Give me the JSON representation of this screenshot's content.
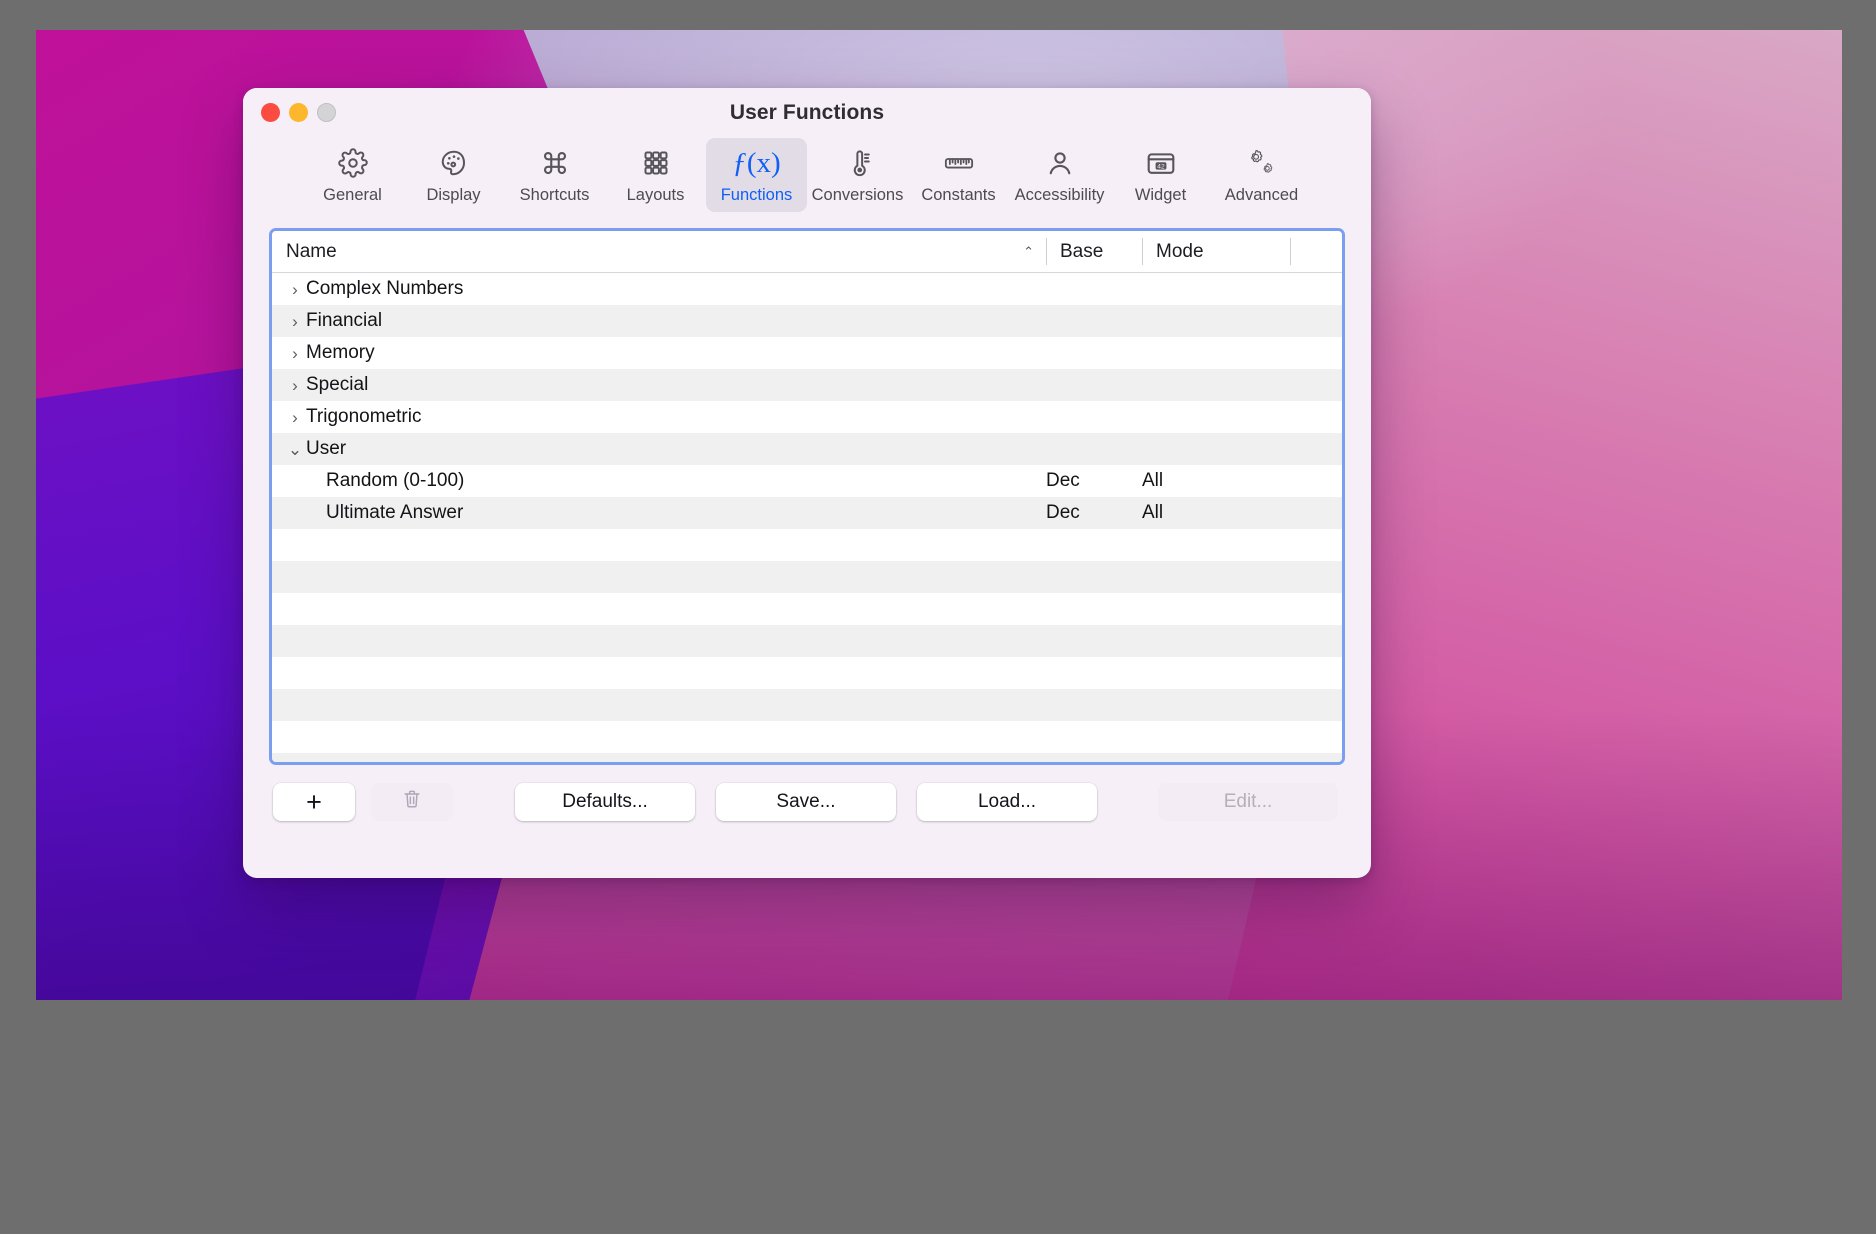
{
  "window": {
    "title": "User Functions",
    "traffic_lights": [
      {
        "name": "close",
        "color": "#fc4b41"
      },
      {
        "name": "minimize",
        "color": "#fdb72c"
      },
      {
        "name": "zoom",
        "color": "#d4d3d5"
      }
    ]
  },
  "toolbar": {
    "items": [
      {
        "label": "General",
        "icon": "gear-icon",
        "selected": false
      },
      {
        "label": "Display",
        "icon": "palette-icon",
        "selected": false
      },
      {
        "label": "Shortcuts",
        "icon": "command-key-icon",
        "selected": false
      },
      {
        "label": "Layouts",
        "icon": "grid-icon",
        "selected": false
      },
      {
        "label": "Functions",
        "icon": "fx-icon",
        "selected": true
      },
      {
        "label": "Conversions",
        "icon": "thermometer-icon",
        "selected": false
      },
      {
        "label": "Constants",
        "icon": "ruler-icon",
        "selected": false
      },
      {
        "label": "Accessibility",
        "icon": "person-icon",
        "selected": false
      },
      {
        "label": "Widget",
        "icon": "widget-42-icon",
        "selected": false
      },
      {
        "label": "Advanced",
        "icon": "two-gears-icon",
        "selected": false
      }
    ],
    "selected_color": "#1160f5"
  },
  "table": {
    "columns": [
      {
        "key": "name",
        "label": "Name",
        "sort": "ascending",
        "sort_glyph": "⌃"
      },
      {
        "key": "base",
        "label": "Base"
      },
      {
        "key": "mode",
        "label": "Mode"
      }
    ],
    "focus_ring_color": "#7a9ef0",
    "rows": [
      {
        "type": "group",
        "expanded": false,
        "chevron": "›",
        "name": "Complex Numbers",
        "base": "",
        "mode": ""
      },
      {
        "type": "group",
        "expanded": false,
        "chevron": "›",
        "name": "Financial",
        "base": "",
        "mode": ""
      },
      {
        "type": "group",
        "expanded": false,
        "chevron": "›",
        "name": "Memory",
        "base": "",
        "mode": ""
      },
      {
        "type": "group",
        "expanded": false,
        "chevron": "›",
        "name": "Special",
        "base": "",
        "mode": ""
      },
      {
        "type": "group",
        "expanded": false,
        "chevron": "›",
        "name": "Trigonometric",
        "base": "",
        "mode": ""
      },
      {
        "type": "group",
        "expanded": true,
        "chevron": "⌄",
        "name": "User",
        "base": "",
        "mode": ""
      },
      {
        "type": "child",
        "expanded": null,
        "chevron": "",
        "name": "Random (0-100)",
        "base": "Dec",
        "mode": "All"
      },
      {
        "type": "child",
        "expanded": null,
        "chevron": "",
        "name": "Ultimate Answer",
        "base": "Dec",
        "mode": "All"
      },
      {
        "type": "empty",
        "chevron": "",
        "name": "",
        "base": "",
        "mode": ""
      },
      {
        "type": "empty",
        "chevron": "",
        "name": "",
        "base": "",
        "mode": ""
      },
      {
        "type": "empty",
        "chevron": "",
        "name": "",
        "base": "",
        "mode": ""
      },
      {
        "type": "empty",
        "chevron": "",
        "name": "",
        "base": "",
        "mode": ""
      },
      {
        "type": "empty",
        "chevron": "",
        "name": "",
        "base": "",
        "mode": ""
      },
      {
        "type": "empty",
        "chevron": "",
        "name": "",
        "base": "",
        "mode": ""
      },
      {
        "type": "empty",
        "chevron": "",
        "name": "",
        "base": "",
        "mode": ""
      },
      {
        "type": "empty",
        "chevron": "",
        "name": "",
        "base": "",
        "mode": ""
      }
    ]
  },
  "buttons": {
    "add": "+",
    "delete_icon": "trash-icon",
    "defaults": "Defaults...",
    "save": "Save...",
    "load": "Load...",
    "edit": "Edit...",
    "edit_disabled": true,
    "delete_disabled": true
  }
}
